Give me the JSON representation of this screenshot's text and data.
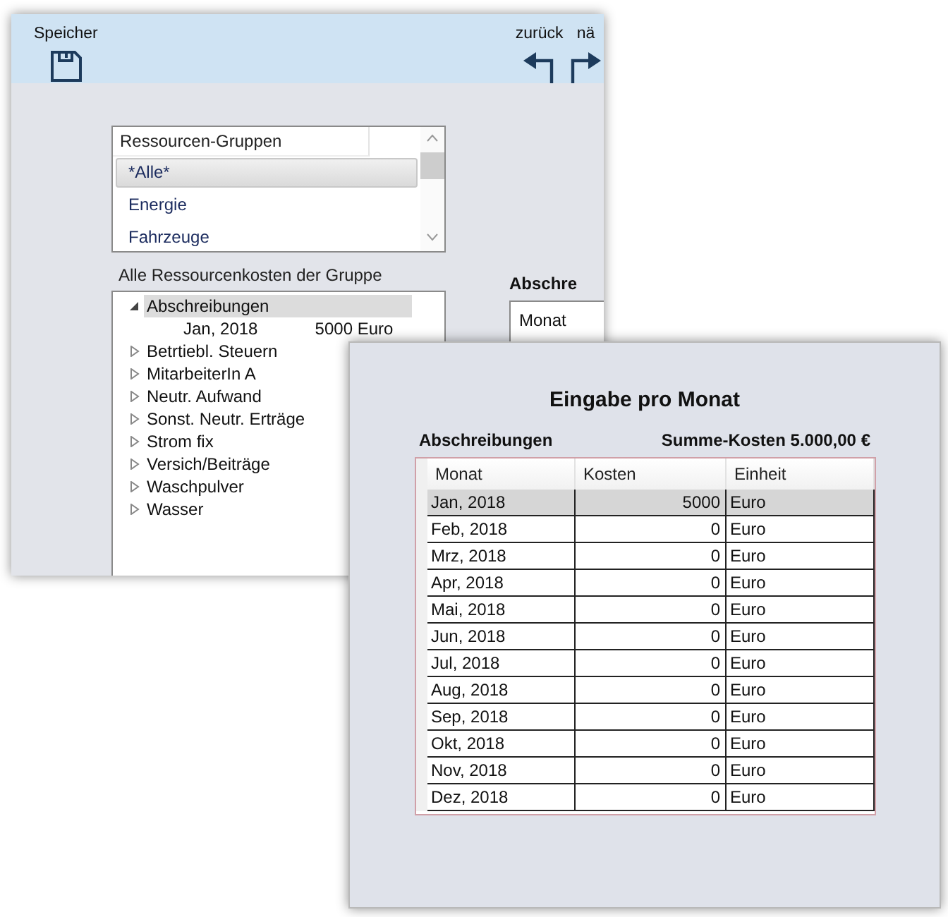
{
  "back_window": {
    "toolbar": [
      {
        "label": "Speicher"
      },
      {
        "label": "zurück"
      },
      {
        "label": "nä"
      }
    ],
    "groups": {
      "header": "Ressourcen-Gruppen",
      "items": [
        {
          "label": "*Alle*",
          "selected": true
        },
        {
          "label": "Energie",
          "selected": false
        },
        {
          "label": "Fahrzeuge",
          "selected": false
        }
      ]
    },
    "tree_label": "Alle Ressourcenkosten der Gruppe",
    "tree": [
      {
        "label": "Abschreibungen",
        "expanded": true,
        "selected": true,
        "children": [
          {
            "month": "Jan, 2018",
            "amount": "5000",
            "unit": "Euro"
          }
        ]
      },
      {
        "label": "Betrtiebl. Steuern",
        "expanded": false,
        "selected": false
      },
      {
        "label": "MitarbeiterIn A",
        "expanded": false,
        "selected": false
      },
      {
        "label": "Neutr. Aufwand",
        "expanded": false,
        "selected": false
      },
      {
        "label": "Sonst. Neutr. Erträge",
        "expanded": false,
        "selected": false
      },
      {
        "label": "Strom fix",
        "expanded": false,
        "selected": false
      },
      {
        "label": "Versich/Beiträge",
        "expanded": false,
        "selected": false
      },
      {
        "label": "Waschpulver",
        "expanded": false,
        "selected": false
      },
      {
        "label": "Wasser",
        "expanded": false,
        "selected": false
      }
    ],
    "side_label": "Abschre",
    "side_grid_column": "Monat"
  },
  "dialog": {
    "title": "Eingabe pro Monat",
    "resource": "Abschreibungen",
    "total": "Summe-Kosten 5.000,00 €",
    "columns": [
      "Monat",
      "Kosten",
      "Einheit"
    ],
    "rows": [
      {
        "month": "Jan, 2018",
        "cost": "5000",
        "unit": "Euro",
        "selected": true
      },
      {
        "month": "Feb, 2018",
        "cost": "0",
        "unit": "Euro",
        "selected": false
      },
      {
        "month": "Mrz, 2018",
        "cost": "0",
        "unit": "Euro",
        "selected": false
      },
      {
        "month": "Apr, 2018",
        "cost": "0",
        "unit": "Euro",
        "selected": false
      },
      {
        "month": "Mai, 2018",
        "cost": "0",
        "unit": "Euro",
        "selected": false
      },
      {
        "month": "Jun, 2018",
        "cost": "0",
        "unit": "Euro",
        "selected": false
      },
      {
        "month": "Jul, 2018",
        "cost": "0",
        "unit": "Euro",
        "selected": false
      },
      {
        "month": "Aug, 2018",
        "cost": "0",
        "unit": "Euro",
        "selected": false
      },
      {
        "month": "Sep, 2018",
        "cost": "0",
        "unit": "Euro",
        "selected": false
      },
      {
        "month": "Okt, 2018",
        "cost": "0",
        "unit": "Euro",
        "selected": false
      },
      {
        "month": "Nov, 2018",
        "cost": "0",
        "unit": "Euro",
        "selected": false
      },
      {
        "month": "Dez, 2018",
        "cost": "0",
        "unit": "Euro",
        "selected": false
      }
    ]
  }
}
